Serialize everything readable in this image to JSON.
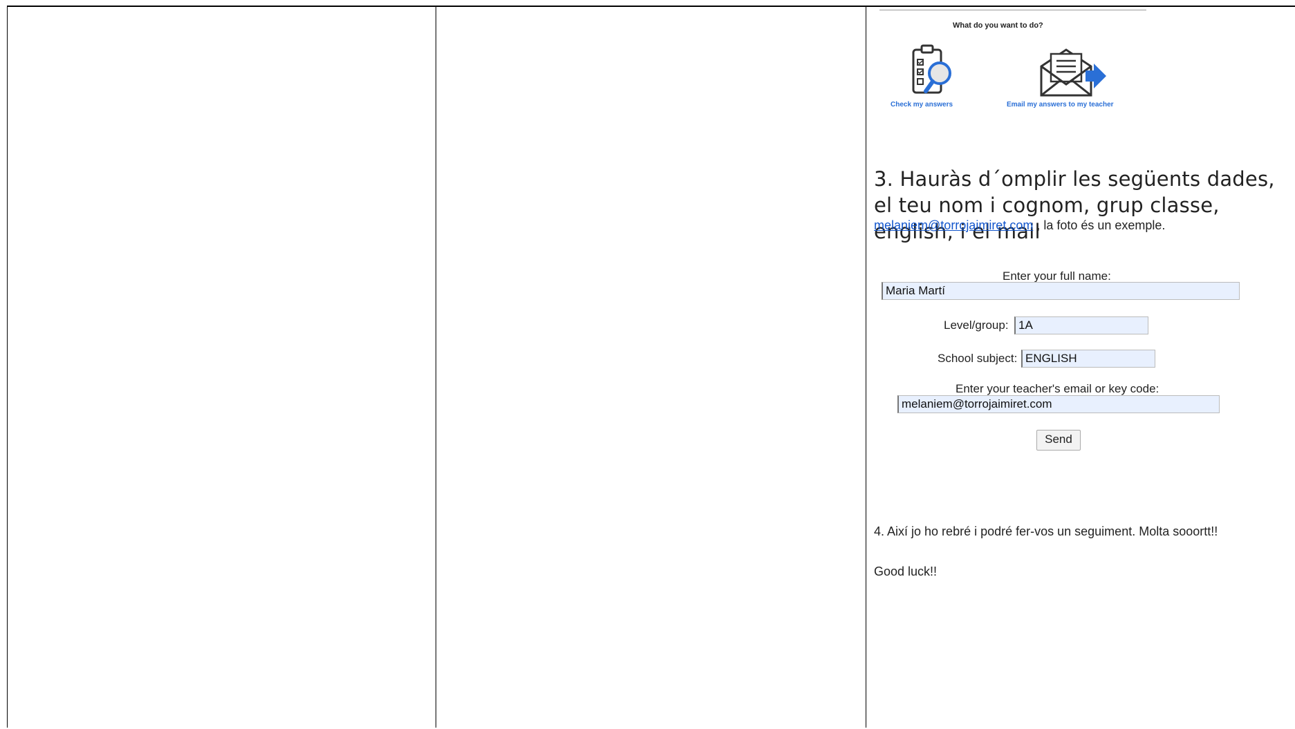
{
  "screenshot": {
    "prompt": "What do you want to do?",
    "check_label": "Check my answers",
    "email_label": "Email my answers to my teacher",
    "icon_accent": "#2a6fd6"
  },
  "instruction3": {
    "text": "3. Hauràs d´omplir les següents dades, el teu nom i cognom, grup classe, english, i el mail",
    "email_link": "melaniem@torrojaimiret.com",
    "suffix": " , la foto és un exemple."
  },
  "form": {
    "name_label": "Enter your full name:",
    "name_value": "Maria Martí",
    "level_label": "Level/group:",
    "level_value": "1A",
    "subject_label": "School subject:",
    "subject_value": "ENGLISH",
    "email_label": "Enter your teacher's email or key code:",
    "email_value": "melaniem@torrojaimiret.com",
    "send_label": "Send"
  },
  "instruction4": "4. Així jo ho rebré i podré fer-vos un seguiment. Molta sooortt!!",
  "closing": "Good luck!!"
}
